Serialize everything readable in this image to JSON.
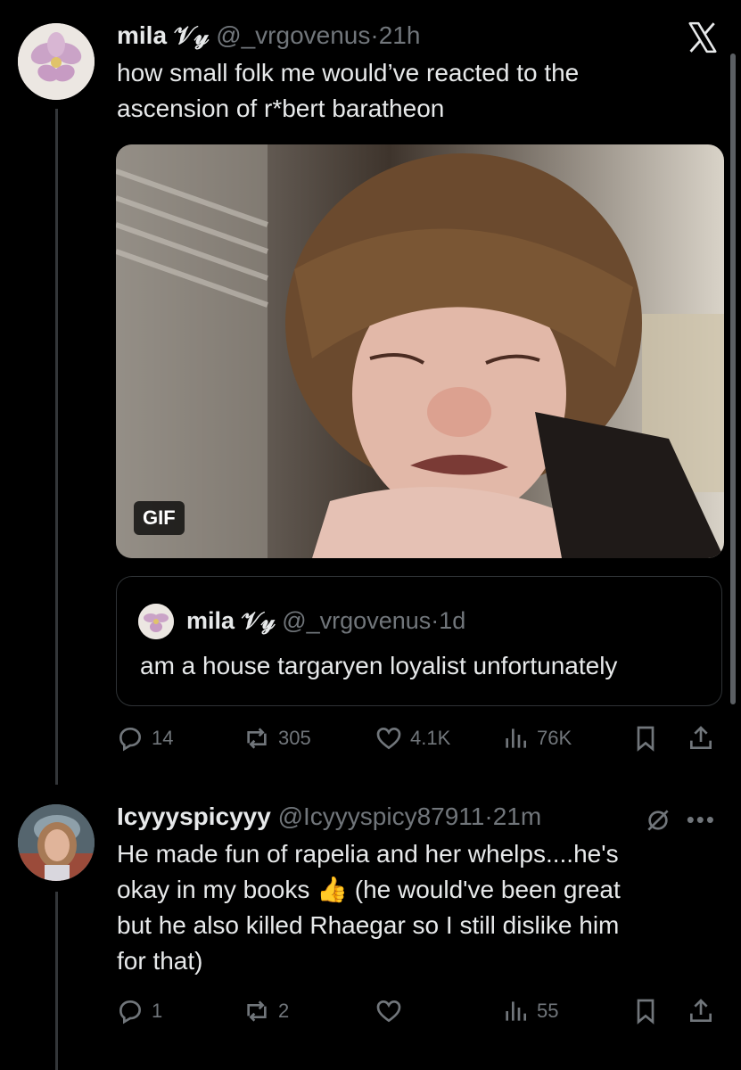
{
  "tweet1": {
    "display_name": "mila",
    "emoji_badge": "𝒱𝓎",
    "handle": "@_vrgovenus",
    "separator": "·",
    "time": "21h",
    "text": "how small folk me would’ve reacted to the ascension of r*bert baratheon",
    "media_badge": "GIF",
    "quote": {
      "display_name": "mila",
      "emoji_badge": "𝒱𝓎",
      "handle": "@_vrgovenus",
      "separator": "·",
      "time": "1d",
      "text": "am a house targaryen loyalist unfortunately"
    },
    "stats": {
      "replies": "14",
      "reposts": "305",
      "likes": "4.1K",
      "views": "76K"
    }
  },
  "tweet2": {
    "display_name": "Icyyyspicyyy",
    "handle": "@Icyyyspicy87911",
    "separator": "·",
    "time": "21m",
    "text_line1": "He made fun of rapelia and her whelps....he's",
    "text_line2a": "okay in my books ",
    "emoji": "👍",
    "text_line2b": " (he would've been great",
    "text_line3": "but he also killed Rhaegar so I still dislike him",
    "text_line4": "for that)",
    "more": "•••",
    "stats": {
      "replies": "1",
      "reposts": "2",
      "likes": "",
      "views": "55"
    }
  },
  "colors": {
    "background": "#000000",
    "text": "#e7e9ea",
    "muted": "#71767b",
    "border": "#2f3336"
  },
  "icons": [
    "x-logo-icon",
    "reply-icon",
    "repost-icon",
    "like-icon",
    "views-icon",
    "bookmark-icon",
    "share-icon",
    "grok-icon"
  ]
}
